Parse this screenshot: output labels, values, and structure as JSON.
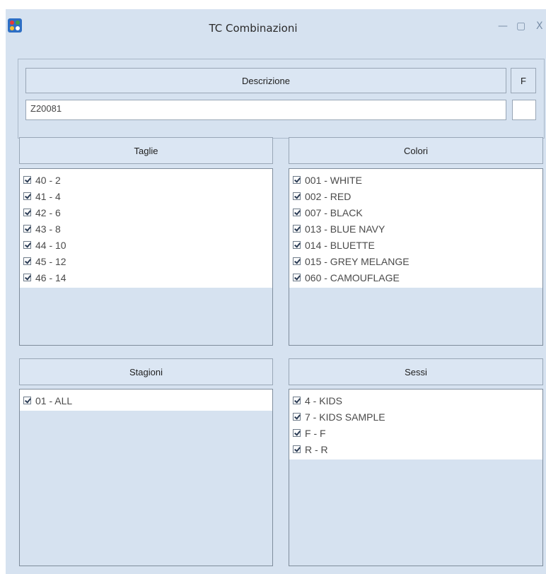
{
  "window": {
    "title": "TC Combinazioni"
  },
  "controls": {
    "minimize": "—",
    "maximize": "▢",
    "close": "X"
  },
  "icons": {
    "app": "app-logo-icon"
  },
  "description": {
    "header": "Descrizione",
    "value": "Z20081",
    "f_header": "F",
    "f_value": ""
  },
  "taglie": {
    "header": "Taglie",
    "items": [
      "40 - 2",
      "41 - 4",
      "42 - 6",
      "43 - 8",
      "44 - 10",
      "45 - 12",
      "46 - 14"
    ]
  },
  "colori": {
    "header": "Colori",
    "items": [
      "001 - WHITE",
      "002 - RED",
      "007 - BLACK",
      "013 - BLUE NAVY",
      "014 - BLUETTE",
      "015 - GREY MELANGE",
      "060 - CAMOUFLAGE"
    ]
  },
  "stagioni": {
    "header": "Stagioni",
    "items": [
      "01 - ALL"
    ]
  },
  "sessi": {
    "header": "Sessi",
    "items": [
      "4 - KIDS",
      "7 - KIDS SAMPLE",
      "F - F",
      "R - R"
    ]
  }
}
